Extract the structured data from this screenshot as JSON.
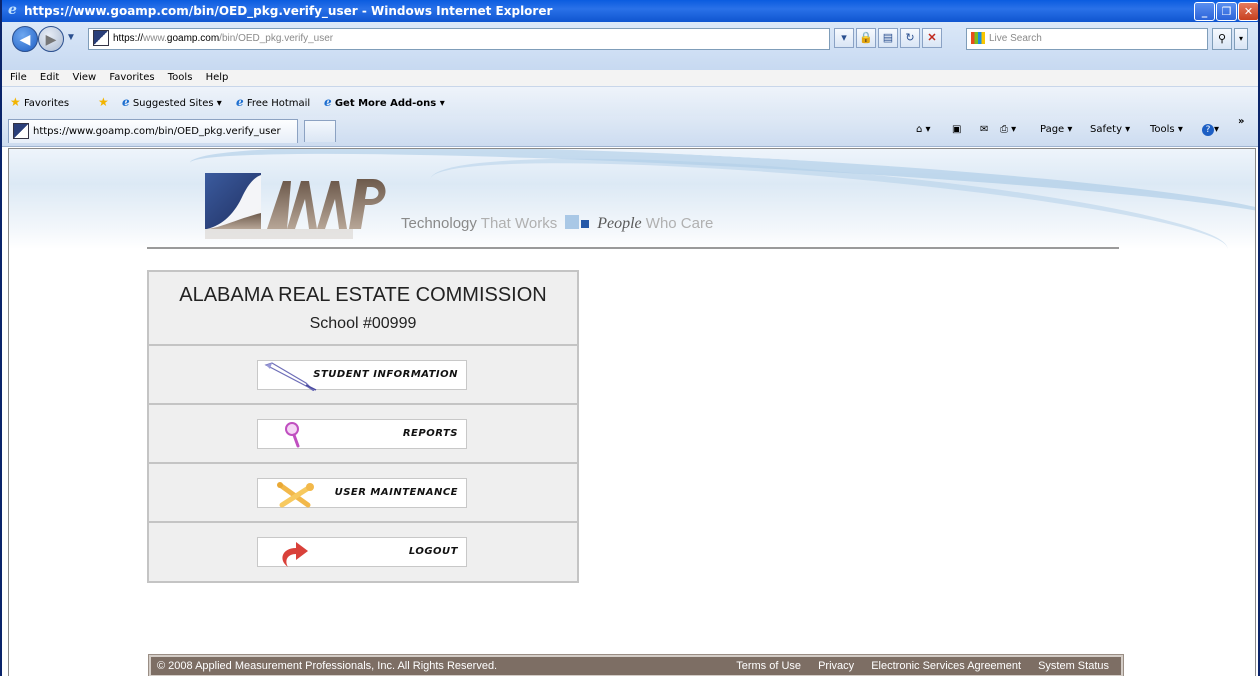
{
  "window": {
    "title": "https://www.goamp.com/bin/OED_pkg.verify_user - Windows Internet Explorer",
    "buttons": {
      "minimize": "_",
      "maximize": "❐",
      "close": "✕"
    }
  },
  "address_bar": {
    "url_scheme": "https://",
    "url_pre": "www.",
    "url_domain": "goamp.com",
    "url_path": "/bin/OED_pkg.verify_user",
    "search_placeholder": "Live Search"
  },
  "menu_bar": [
    "File",
    "Edit",
    "View",
    "Favorites",
    "Tools",
    "Help"
  ],
  "favorites_bar": {
    "favorites": "Favorites",
    "suggested_sites": "Suggested Sites ▾",
    "free_hotmail": "Free Hotmail",
    "get_more_addons": "Get More Add-ons ▾"
  },
  "tabs": {
    "active_tab": "https://www.goamp.com/bin/OED_pkg.verify_user"
  },
  "command_bar": {
    "home": "▾",
    "page": "Page ▾",
    "safety": "Safety ▾",
    "tools": "Tools ▾",
    "help": "▾",
    "more": "»"
  },
  "banner": {
    "tagline_technology": "Technology",
    "tagline_that_works": "That Works",
    "tagline_people": "People",
    "tagline_who_care": "Who Care"
  },
  "panel": {
    "org_name": "ALABAMA REAL ESTATE COMMISSION",
    "school": "School #00999",
    "items": [
      {
        "label": "STUDENT INFORMATION",
        "icon": "pen-icon"
      },
      {
        "label": "REPORTS",
        "icon": "magnifier-icon"
      },
      {
        "label": "USER MAINTENANCE",
        "icon": "tools-icon"
      },
      {
        "label": "LOGOUT",
        "icon": "return-arrow-icon"
      }
    ]
  },
  "footer": {
    "copyright": "© 2008 Applied Measurement Professionals, Inc. All Rights Reserved.",
    "links": [
      "Terms of Use",
      "Privacy",
      "Electronic Services Agreement",
      "System Status"
    ]
  },
  "colors": {
    "titlebar_blue": "#0b5cdf",
    "footer_brown": "#7d6e64",
    "panel_gray": "#efefef",
    "logo_navy": "#2a3f7a",
    "logo_brown": "#8a7766"
  }
}
